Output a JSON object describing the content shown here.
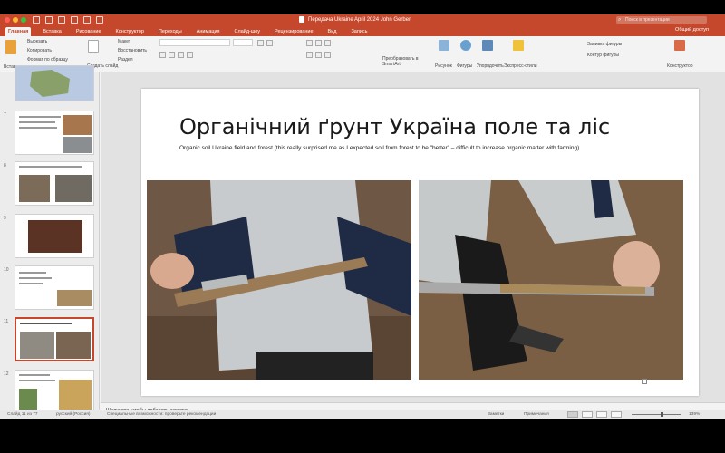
{
  "app": {
    "accent": "#c5482c",
    "document_title": "Передача Ukraine April 2024 John Gerber",
    "search_placeholder": "Поиск в презентации",
    "share_label": "Общий доступ"
  },
  "tabs": [
    "Главная",
    "Вставка",
    "Рисование",
    "Конструктор",
    "Переходы",
    "Анимация",
    "Слайд-шоу",
    "Рецензирование",
    "Вид",
    "Запись"
  ],
  "ribbon": {
    "paste": "Вставить",
    "cut": "Вырезать",
    "copy": "Копировать",
    "format_painter": "Формат по образцу",
    "new_slide": "Создать слайд",
    "layout": "Макет",
    "reset": "Восстановить",
    "section": "Раздел",
    "convert_smartart": "Преобразовать в SmartArt",
    "picture": "Рисунок",
    "shapes": "Фигуры",
    "arrange": "Упорядочить",
    "quick_styles": "Экспресс-стили",
    "shape_fill": "Заливка фигуры",
    "shape_outline": "Контур фигуры",
    "design_ideas": "Конструктор"
  },
  "thumbnails": [
    {
      "number": "",
      "selected": false
    },
    {
      "number": "7",
      "selected": false
    },
    {
      "number": "8",
      "selected": false
    },
    {
      "number": "9",
      "selected": false
    },
    {
      "number": "10",
      "selected": false
    },
    {
      "number": "11",
      "selected": true
    },
    {
      "number": "12",
      "selected": false
    }
  ],
  "slide": {
    "title": "Органічний ґрунт Україна поле та ліс",
    "subtitle": "Organic soil Ukraine  field and forest  (this really surprised me as I expected soil from forest to be \"better\" – difficult to increase organic matter with farming)"
  },
  "notes": {
    "placeholder": "Щелкните, чтобы добавить заметки"
  },
  "status": {
    "slide_counter": "Слайд 11 из 77",
    "language": "русский (Россия)",
    "accessibility": "Специальные возможности: проверьте рекомендации",
    "notes_button": "Заметки",
    "comments_button": "Примечания",
    "zoom": "139%",
    "zoom_level": 0.62
  }
}
